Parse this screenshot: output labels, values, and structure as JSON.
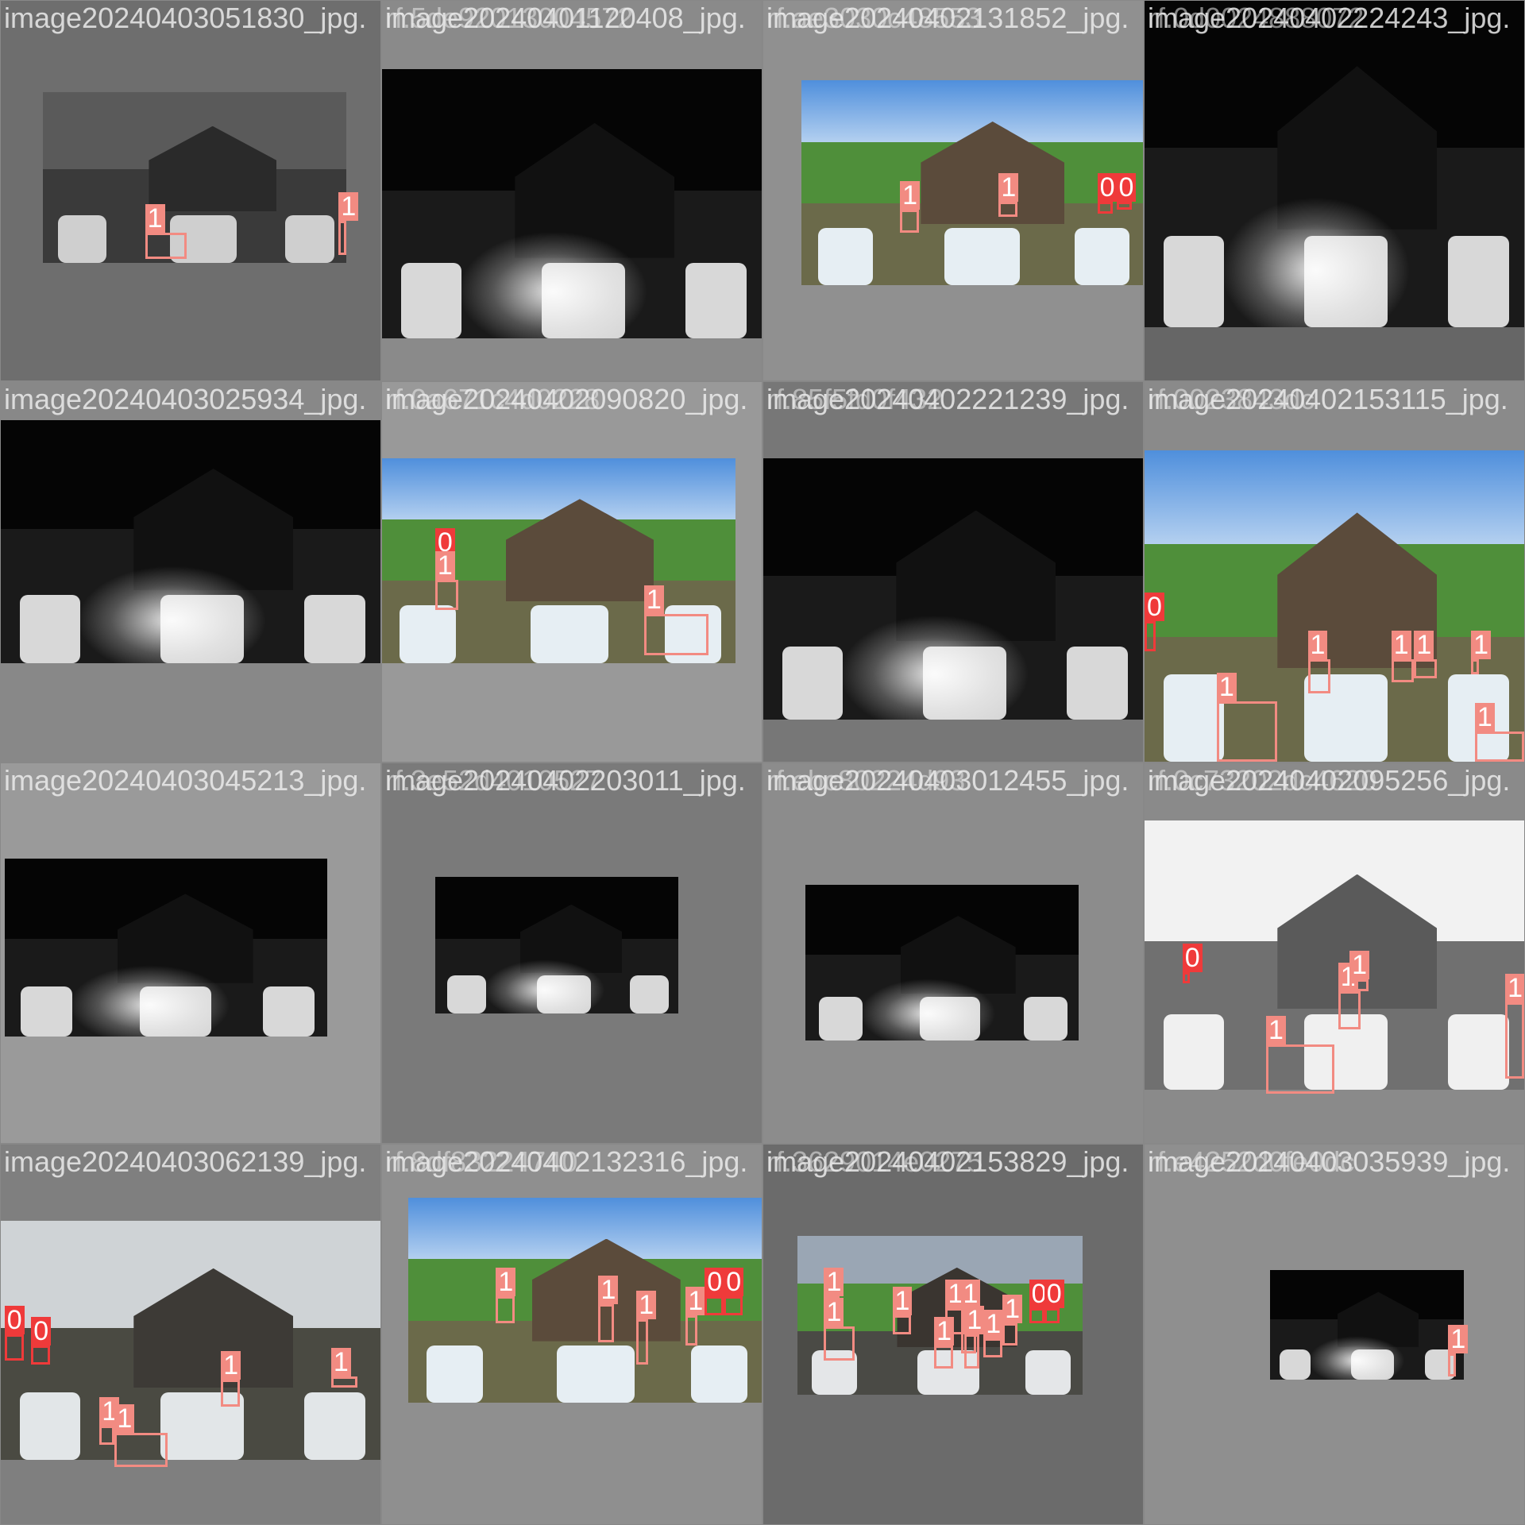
{
  "colors": {
    "box_class_1": "#f28b82",
    "box_class_0": "#ef3a3a",
    "caption_text": "#ebebeb"
  },
  "tiles": [
    {
      "caption": "image20240403051830_jpg.",
      "overlay": "",
      "bg": "#6e6e6e",
      "scene": "dusk",
      "photo": [
        0.11,
        0.24,
        0.91,
        0.69
      ],
      "boxes": [
        {
          "label": "1",
          "r": [
            0.38,
            0.61,
            0.49,
            0.68
          ]
        },
        {
          "label": "1",
          "r": [
            0.89,
            0.58,
            0.91,
            0.67
          ]
        }
      ]
    },
    {
      "caption": "image20240401120408_jpg.",
      "overlay": "rf.5de92013004572",
      "bg": "#8a8a8a",
      "scene": "night",
      "photo": [
        0.0,
        0.18,
        1.0,
        0.89
      ],
      "boxes": []
    },
    {
      "caption": "image20240402131852_jpg.",
      "overlay": "rf.ae3030c48553",
      "bg": "#909090",
      "scene": "day",
      "photo": [
        0.1,
        0.21,
        1.0,
        0.75
      ],
      "boxes": [
        {
          "label": "1",
          "r": [
            0.36,
            0.55,
            0.41,
            0.61
          ]
        },
        {
          "label": "1",
          "r": [
            0.62,
            0.53,
            0.67,
            0.57
          ]
        },
        {
          "label": "0",
          "r": [
            0.88,
            0.53,
            0.92,
            0.56
          ]
        },
        {
          "label": "0",
          "r": [
            0.93,
            0.53,
            0.97,
            0.55
          ]
        }
      ]
    },
    {
      "caption": "image20240402224243_jpg.",
      "overlay": "rf.0d0024888072",
      "bg": "#666666",
      "scene": "night",
      "photo": [
        0.0,
        0.0,
        1.0,
        0.86
      ],
      "boxes": []
    },
    {
      "caption": "image20240403025934_jpg.",
      "overlay": "",
      "bg": "#888888",
      "scene": "night",
      "photo": [
        0.0,
        0.1,
        1.0,
        0.74
      ],
      "boxes": []
    },
    {
      "caption": "image20240402090820_jpg.",
      "overlay": "rf.0a671c4d0228",
      "bg": "#999999",
      "scene": "day",
      "photo": [
        0.0,
        0.2,
        0.93,
        0.74
      ],
      "boxes": [
        {
          "label": "0",
          "r": [
            0.14,
            0.46,
            0.19,
            0.52
          ]
        },
        {
          "label": "1",
          "r": [
            0.14,
            0.52,
            0.2,
            0.6
          ]
        },
        {
          "label": "1",
          "r": [
            0.69,
            0.61,
            0.86,
            0.72
          ]
        }
      ]
    },
    {
      "caption": "image20240402221239_jpg.",
      "overlay": "rf.85f5fd0f432",
      "bg": "#777777",
      "scene": "night",
      "photo": [
        0.0,
        0.2,
        1.0,
        0.89
      ],
      "boxes": []
    },
    {
      "caption": "image20240402153115_jpg.",
      "overlay": "rf.0023843dc",
      "bg": "#8a8a8a",
      "scene": "day",
      "photo": [
        0.0,
        0.18,
        1.0,
        1.0
      ],
      "boxes": [
        {
          "label": "0",
          "r": [
            0.0,
            0.63,
            0.03,
            0.71
          ]
        },
        {
          "label": "1",
          "r": [
            0.43,
            0.73,
            0.49,
            0.82
          ]
        },
        {
          "label": "1",
          "r": [
            0.65,
            0.73,
            0.71,
            0.79
          ]
        },
        {
          "label": "1",
          "r": [
            0.71,
            0.73,
            0.77,
            0.78
          ]
        },
        {
          "label": "1",
          "r": [
            0.86,
            0.73,
            0.88,
            0.77
          ]
        },
        {
          "label": "1",
          "r": [
            0.19,
            0.84,
            0.35,
            1.0
          ]
        },
        {
          "label": "1",
          "r": [
            0.87,
            0.92,
            1.0,
            1.0
          ]
        }
      ]
    },
    {
      "caption": "image20240403045213_jpg.",
      "overlay": "",
      "bg": "#9a9a9a",
      "scene": "night",
      "photo": [
        0.01,
        0.25,
        0.86,
        0.72
      ],
      "boxes": []
    },
    {
      "caption": "image20240402203011_jpg.",
      "overlay": "rf.3e52d4010527",
      "bg": "#7a7a7a",
      "scene": "night",
      "photo": [
        0.14,
        0.3,
        0.78,
        0.66
      ],
      "boxes": []
    },
    {
      "caption": "image20240403012455_jpg.",
      "overlay": "rf.ebc80224d93",
      "bg": "#8c8c8c",
      "scene": "night",
      "photo": [
        0.11,
        0.32,
        0.83,
        0.73
      ],
      "boxes": []
    },
    {
      "caption": "image20240402095256_jpg.",
      "overlay": "rf.0c73202dc4620",
      "bg": "#8a8a8a",
      "scene": "bw",
      "photo": [
        0.0,
        0.15,
        1.0,
        0.86
      ],
      "boxes": [
        {
          "label": "0",
          "r": [
            0.1,
            0.55,
            0.12,
            0.58
          ]
        },
        {
          "label": "1",
          "r": [
            0.51,
            0.6,
            0.57,
            0.7
          ]
        },
        {
          "label": "1",
          "r": [
            0.54,
            0.57,
            0.59,
            0.6
          ]
        },
        {
          "label": "1",
          "r": [
            0.32,
            0.74,
            0.5,
            0.87
          ]
        },
        {
          "label": "1",
          "r": [
            0.95,
            0.63,
            1.0,
            0.83
          ]
        }
      ]
    },
    {
      "caption": "image20240403062139_jpg.",
      "overlay": "",
      "bg": "#7f7f7f",
      "scene": "overcast",
      "photo": [
        0.0,
        0.2,
        1.0,
        0.83
      ],
      "boxes": [
        {
          "label": "0",
          "r": [
            0.01,
            0.5,
            0.06,
            0.57
          ]
        },
        {
          "label": "0",
          "r": [
            0.08,
            0.53,
            0.13,
            0.58
          ]
        },
        {
          "label": "1",
          "r": [
            0.58,
            0.62,
            0.63,
            0.69
          ]
        },
        {
          "label": "1",
          "r": [
            0.87,
            0.61,
            0.94,
            0.64
          ]
        },
        {
          "label": "1",
          "r": [
            0.26,
            0.74,
            0.3,
            0.79
          ]
        },
        {
          "label": "1",
          "r": [
            0.3,
            0.76,
            0.44,
            0.85
          ]
        }
      ]
    },
    {
      "caption": "image20240402132316_jpg.",
      "overlay": "rf.8df83224740",
      "bg": "#8f8f8f",
      "scene": "day",
      "photo": [
        0.07,
        0.14,
        1.0,
        0.68
      ],
      "boxes": [
        {
          "label": "1",
          "r": [
            0.3,
            0.4,
            0.35,
            0.47
          ]
        },
        {
          "label": "1",
          "r": [
            0.57,
            0.42,
            0.61,
            0.52
          ]
        },
        {
          "label": "1",
          "r": [
            0.67,
            0.46,
            0.7,
            0.58
          ]
        },
        {
          "label": "1",
          "r": [
            0.8,
            0.45,
            0.83,
            0.53
          ]
        },
        {
          "label": "0",
          "r": [
            0.85,
            0.4,
            0.9,
            0.45
          ]
        },
        {
          "label": "0",
          "r": [
            0.9,
            0.4,
            0.95,
            0.45
          ]
        }
      ]
    },
    {
      "caption": "image20240402153829_jpg.",
      "overlay": "rf.3629014e0275",
      "bg": "#6b6b6b",
      "scene": "dim",
      "photo": [
        0.09,
        0.24,
        0.84,
        0.66
      ],
      "boxes": [
        {
          "label": "1",
          "r": [
            0.16,
            0.4,
            0.2,
            0.46
          ]
        },
        {
          "label": "1",
          "r": [
            0.16,
            0.48,
            0.24,
            0.57
          ]
        },
        {
          "label": "1",
          "r": [
            0.34,
            0.45,
            0.39,
            0.5
          ]
        },
        {
          "label": "1",
          "r": [
            0.48,
            0.43,
            0.53,
            0.5
          ]
        },
        {
          "label": "1",
          "r": [
            0.52,
            0.43,
            0.56,
            0.55
          ]
        },
        {
          "label": "1",
          "r": [
            0.45,
            0.53,
            0.5,
            0.59
          ]
        },
        {
          "label": "1",
          "r": [
            0.53,
            0.5,
            0.57,
            0.59
          ]
        },
        {
          "label": "1",
          "r": [
            0.58,
            0.51,
            0.63,
            0.56
          ]
        },
        {
          "label": "1",
          "r": [
            0.63,
            0.47,
            0.67,
            0.53
          ]
        },
        {
          "label": "0",
          "r": [
            0.7,
            0.43,
            0.74,
            0.47
          ]
        },
        {
          "label": "0",
          "r": [
            0.74,
            0.43,
            0.78,
            0.47
          ]
        }
      ]
    },
    {
      "caption": "image20240403035939_jpg.",
      "overlay": "rf.e4252d0fe0dc",
      "bg": "#8f8f8f",
      "scene": "night",
      "photo": [
        0.33,
        0.33,
        0.84,
        0.62
      ],
      "boxes": [
        {
          "label": "1",
          "r": [
            0.8,
            0.55,
            0.82,
            0.61
          ]
        }
      ]
    }
  ]
}
